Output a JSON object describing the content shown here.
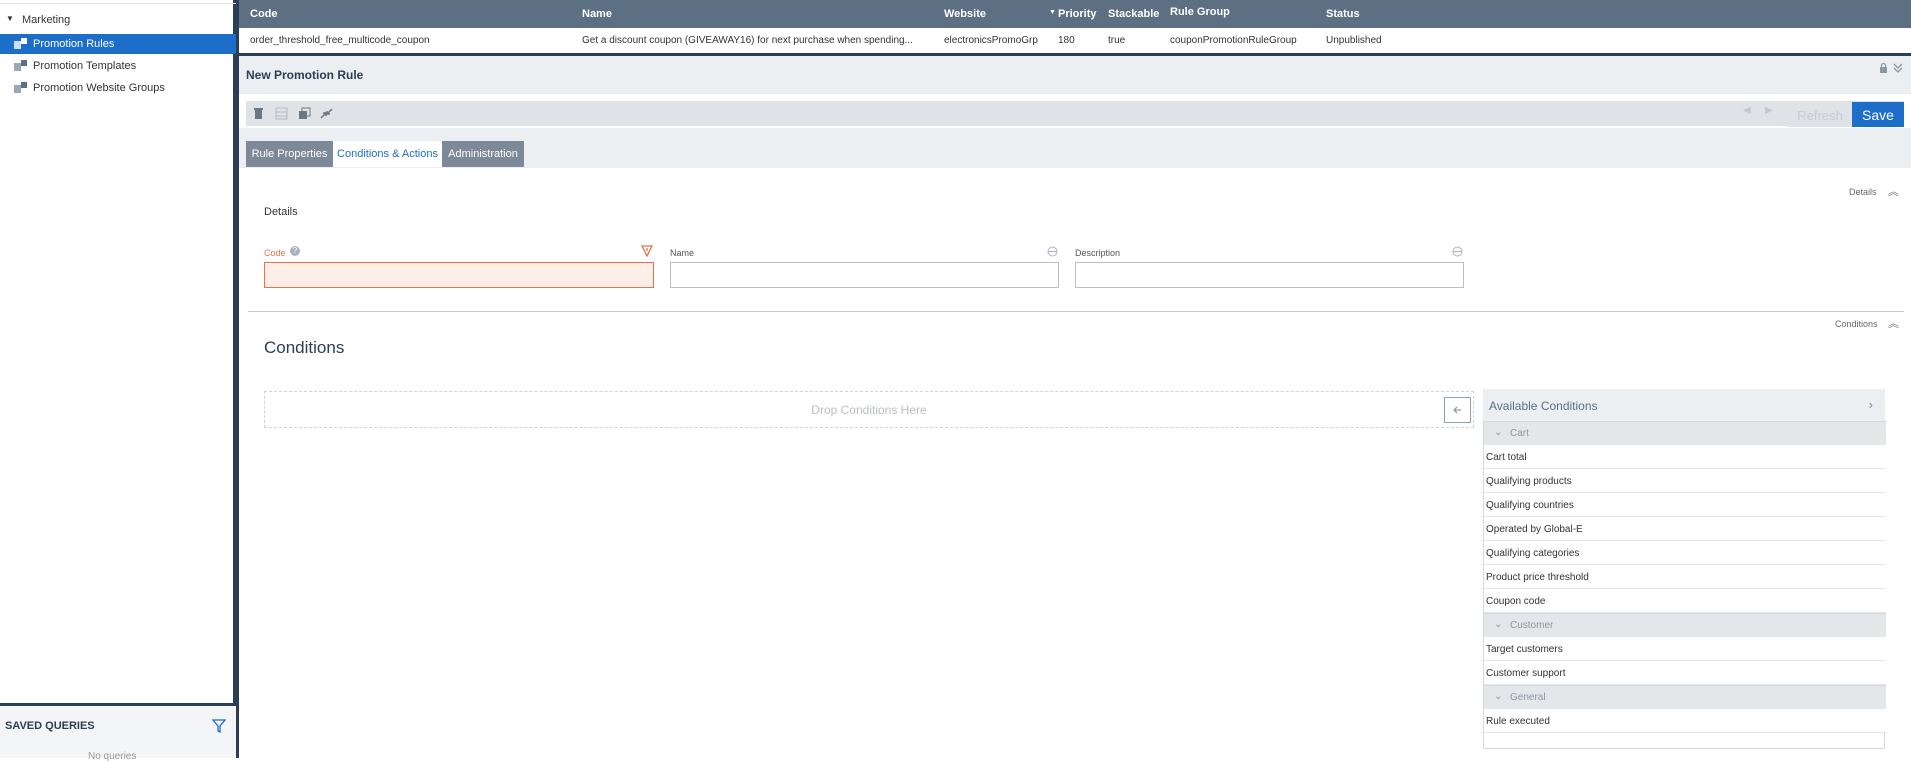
{
  "sidebar": {
    "root_label": "Marketing",
    "items": [
      {
        "label": "Promotion Rules",
        "selected": true
      },
      {
        "label": "Promotion Templates",
        "selected": false
      },
      {
        "label": "Promotion Website Groups",
        "selected": false
      }
    ],
    "saved_queries": {
      "title": "SAVED QUERIES",
      "empty_text": "No queries"
    }
  },
  "grid": {
    "columns": [
      "Code",
      "Name",
      "Website",
      "Priority",
      "Stackable",
      "Rule Group",
      "Status"
    ],
    "row": {
      "code": "order_threshold_free_multicode_coupon",
      "name": "Get a discount coupon (GIVEAWAY16) for next purchase when spending...",
      "website": "electronicsPromoGrp",
      "priority": "180",
      "stackable": "true",
      "rule_group": "couponPromotionRuleGroup",
      "status": "Unpublished"
    }
  },
  "editor": {
    "title": "New Promotion Rule",
    "refresh_label": "Refresh",
    "save_label": "Save",
    "tabs": [
      {
        "label": "Rule Properties"
      },
      {
        "label": "Conditions & Actions"
      },
      {
        "label": "Administration"
      }
    ],
    "details": {
      "section_label": "Details",
      "heading": "Details",
      "code_label": "Code",
      "name_label": "Name",
      "description_label": "Description",
      "code_value": "",
      "name_value": "",
      "description_value": ""
    },
    "conditions": {
      "section_label": "Conditions",
      "heading": "Conditions",
      "drop_text": "Drop Conditions Here",
      "available_title": "Available Conditions",
      "groups": [
        {
          "label": "Cart",
          "items": [
            "Cart total",
            "Qualifying products",
            "Qualifying countries",
            "Operated by Global-E",
            "Qualifying categories",
            "Product price threshold",
            "Coupon code"
          ]
        },
        {
          "label": "Customer",
          "items": [
            "Target customers",
            "Customer support"
          ]
        },
        {
          "label": "General",
          "items": [
            "Rule executed"
          ]
        }
      ]
    }
  },
  "colors": {
    "accent": "#1c6ec9",
    "header": "#5d6f83",
    "error": "#e5734e"
  }
}
